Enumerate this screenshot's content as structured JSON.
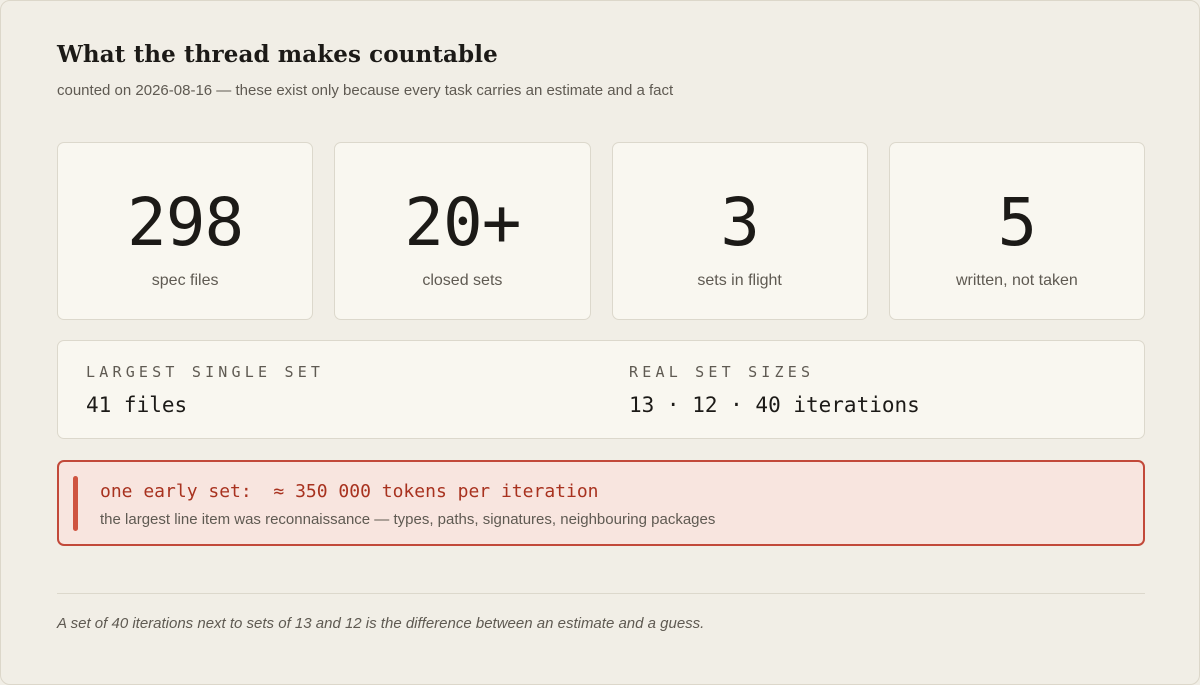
{
  "header": {
    "title": "What the thread makes countable",
    "subtitle": "counted on 2026-08-16 — these exist only because every task carries an estimate and a fact"
  },
  "stats": [
    {
      "value": "298",
      "label": "spec files"
    },
    {
      "value": "20+",
      "label": "closed sets"
    },
    {
      "value": "3",
      "label": "sets in flight"
    },
    {
      "value": "5",
      "label": "written, not taken"
    }
  ],
  "facts": {
    "largest": {
      "label": "LARGEST SINGLE SET",
      "value": "41 files"
    },
    "sizes": {
      "label": "REAL SET SIZES",
      "value": "13 · 12 · 40 iterations"
    }
  },
  "callout": {
    "heading": "one early set:  ≈ 350 000 tokens per iteration",
    "text": "the largest line item was reconnaissance — types, paths, signatures, neighbouring packages",
    "accent_color": "#c2493a"
  },
  "footnote": "A set of 40 iterations next to sets of 13 and 12 is the difference between an estimate and a guess."
}
